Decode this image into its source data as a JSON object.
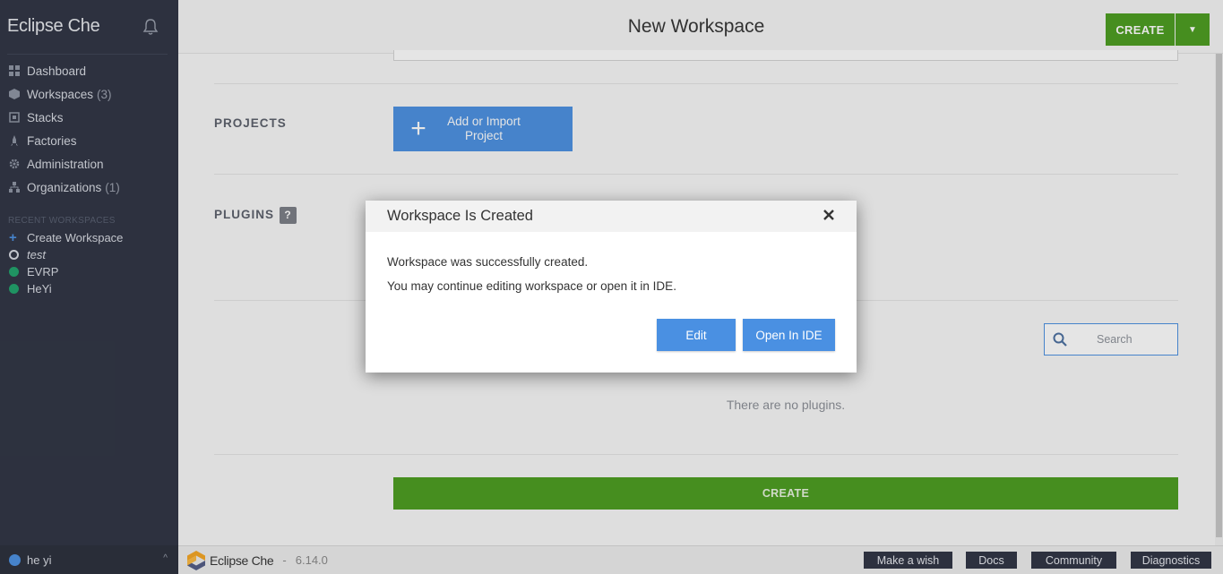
{
  "sidebar": {
    "brand": "Eclipse Che",
    "bell_icon": "bell-icon",
    "nav": [
      {
        "label": "Dashboard",
        "count": "",
        "icon": "dashboard-icon"
      },
      {
        "label": "Workspaces",
        "count": "(3)",
        "icon": "workspaces-icon"
      },
      {
        "label": "Stacks",
        "count": "",
        "icon": "stacks-icon"
      },
      {
        "label": "Factories",
        "count": "",
        "icon": "factories-icon"
      },
      {
        "label": "Administration",
        "count": "",
        "icon": "gear-icon"
      },
      {
        "label": "Organizations",
        "count": "(1)",
        "icon": "organizations-icon"
      }
    ],
    "recent_label": "RECENT WORKSPACES",
    "recent": [
      {
        "label": "Create Workspace",
        "icon": "plus-icon"
      },
      {
        "label": "test",
        "icon": "stopped-status-icon"
      },
      {
        "label": "EVRP",
        "icon": "running-status-icon"
      },
      {
        "label": "HeYi",
        "icon": "running-status-icon"
      }
    ],
    "user": "he yi"
  },
  "header": {
    "title": "New Workspace",
    "create_label": "CREATE"
  },
  "content": {
    "projects_label": "PROJECTS",
    "add_project_label": "Add or Import Project",
    "plugins_label": "PLUGINS",
    "help_badge": "?",
    "search_placeholder": "Search",
    "no_plugins": "There are no plugins.",
    "create_label": "CREATE"
  },
  "footer": {
    "brand": "Eclipse Che",
    "separator": "-",
    "version": "6.14.0",
    "buttons": [
      "Make a wish",
      "Docs",
      "Community",
      "Diagnostics"
    ]
  },
  "modal": {
    "title": "Workspace Is Created",
    "line1": "Workspace was successfully created.",
    "line2": "You may continue editing workspace or open it in IDE.",
    "edit_label": "Edit",
    "open_label": "Open In IDE"
  },
  "colors": {
    "sidebar_bg": "#2e3342",
    "accent_blue": "#4a90e2",
    "create_green": "#4a9c1e",
    "running_green": "#1ea26a"
  }
}
